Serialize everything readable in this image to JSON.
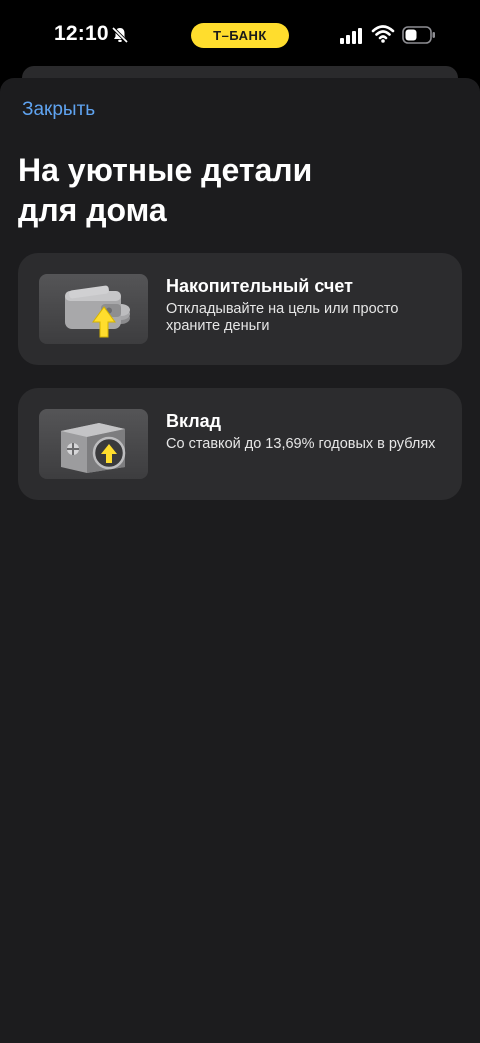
{
  "status_bar": {
    "time": "12:10",
    "bank_label": "Т–БАНК",
    "icons": {
      "mute": "bell-slash-icon",
      "signal": "cellular-signal-icon",
      "wifi": "wifi-icon",
      "battery": "battery-icon"
    }
  },
  "sheet": {
    "close_label": "Закрыть",
    "title_line1": "На уютные детали",
    "title_line2": "для дома"
  },
  "options": [
    {
      "title": "Накопительный счет",
      "description": "Откладывайте на цель или просто храните деньги",
      "icon": "wallet-coins-icon"
    },
    {
      "title": "Вклад",
      "description": "Со ставкой до 13,69% годовых в рублях",
      "icon": "safe-coin-icon"
    }
  ],
  "colors": {
    "background": "#000000",
    "sheet": "#1c1c1e",
    "card": "#2c2c2e",
    "accent_yellow": "#ffdd2d",
    "link_blue": "#5fa3f0"
  }
}
